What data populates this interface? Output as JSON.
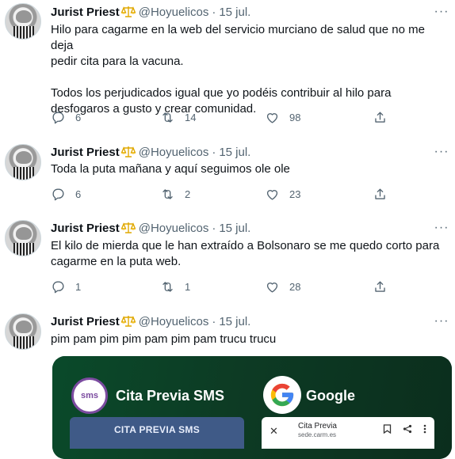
{
  "colors": {
    "text": "#0f1419",
    "secondary": "#536471",
    "media_bg": "#0c3a24",
    "sms_purple": "#7b4ba0"
  },
  "tweets": [
    {
      "name": "Jurist Priest",
      "badge_icon": "scale-icon",
      "handle": "@Hoyuelicos",
      "dot": "·",
      "date": "15 jul.",
      "text_lines": [
        "Hilo para cagarme en la web del servicio murciano de salud que no me deja",
        "pedir cita para la vacuna.",
        "",
        "Todos los perjudicados igual que yo podéis contribuir al hilo para",
        "desfogaros a gusto y crear comunidad."
      ],
      "replies": "6",
      "retweets": "14",
      "likes": "98"
    },
    {
      "name": "Jurist Priest",
      "badge_icon": "scale-icon",
      "handle": "@Hoyuelicos",
      "dot": "·",
      "date": "15 jul.",
      "text_lines": [
        "Toda la puta mañana y aquí seguimos ole ole"
      ],
      "replies": "6",
      "retweets": "2",
      "likes": "23"
    },
    {
      "name": "Jurist Priest",
      "badge_icon": "scale-icon",
      "handle": "@Hoyuelicos",
      "dot": "·",
      "date": "15 jul.",
      "text_lines": [
        "El kilo de mierda que le han extraído a Bolsonaro se me quedo corto para",
        "cagarme en la puta web."
      ],
      "replies": "1",
      "retweets": "1",
      "likes": "28"
    },
    {
      "name": "Jurist Priest",
      "badge_icon": "scale-icon",
      "handle": "@Hoyuelicos",
      "dot": "·",
      "date": "15 jul.",
      "text_lines": [
        "pim pam pim pim pam pim pam trucu trucu"
      ]
    }
  ],
  "media": {
    "sms_logo_text": "sms",
    "title_left": "Cita Previa SMS",
    "title_right": "Google",
    "sms_panel_label": "CITA PREVIA SMS",
    "browser_title": "Cita Previa",
    "browser_url": "sede.carm.es",
    "browser_close": "✕"
  },
  "icons": {
    "more": "···",
    "reply": "reply-icon",
    "retweet": "retweet-icon",
    "like": "like-icon",
    "share": "share-icon"
  }
}
